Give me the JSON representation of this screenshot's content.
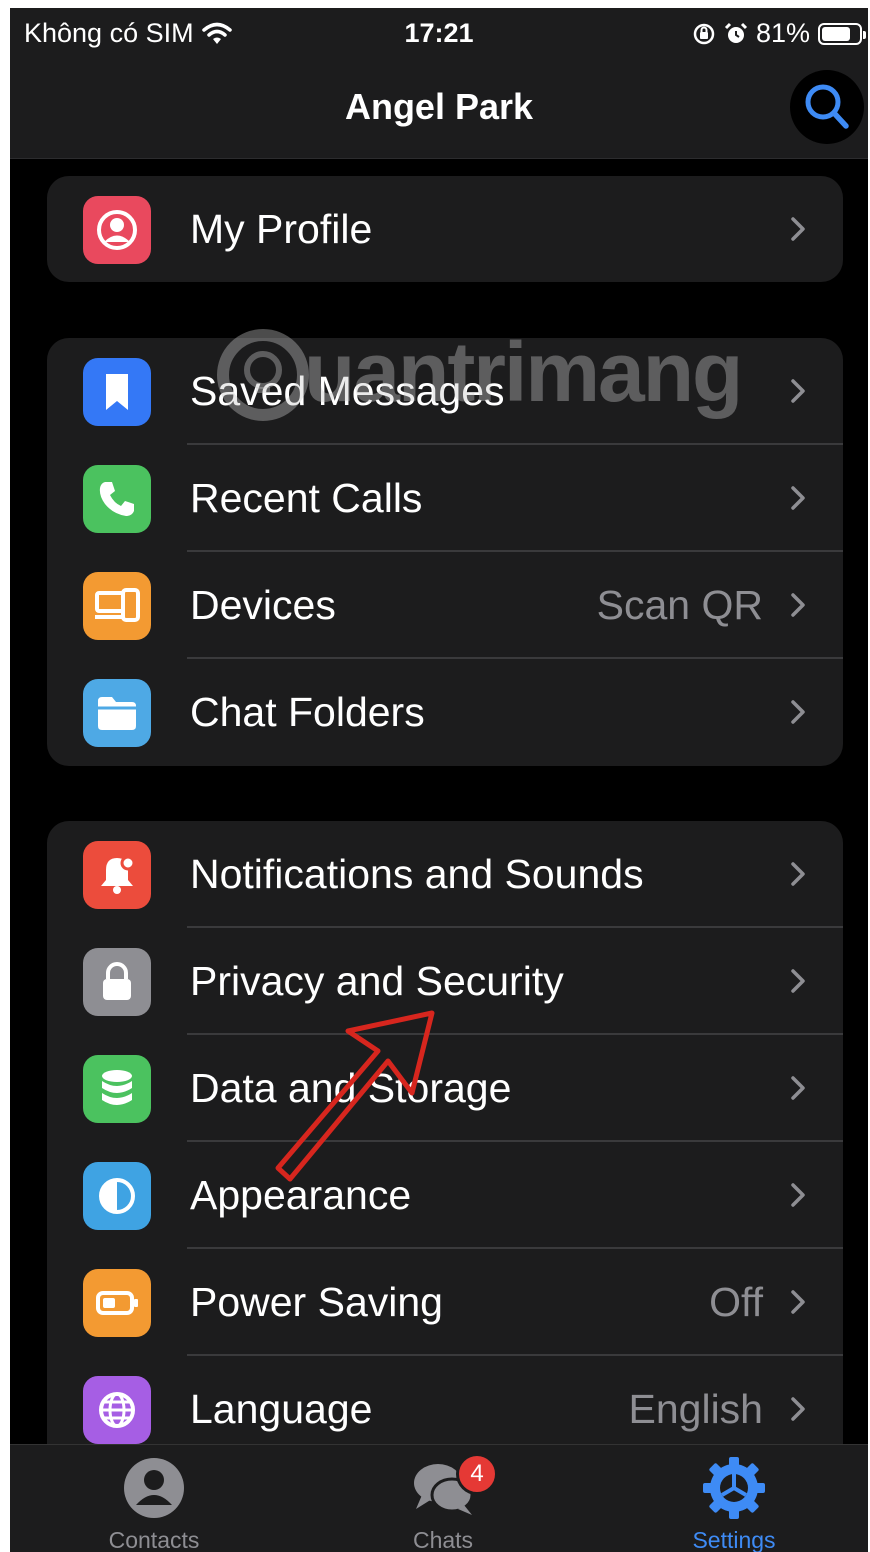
{
  "status": {
    "carrier": "Không có SIM",
    "time": "17:21",
    "battery": "81%",
    "battery_level": 0.81
  },
  "header": {
    "title": "Angel Park",
    "search_icon": "search-icon"
  },
  "groups": [
    {
      "items": [
        {
          "label": "My Profile",
          "icon": "person-icon",
          "color": "#e9495e"
        }
      ]
    },
    {
      "items": [
        {
          "label": "Saved Messages",
          "icon": "bookmark-icon",
          "color": "#3478f6"
        },
        {
          "label": "Recent Calls",
          "icon": "phone-icon",
          "color": "#4bc25f"
        },
        {
          "label": "Devices",
          "value": "Scan QR",
          "icon": "devices-icon",
          "color": "#f39a32"
        },
        {
          "label": "Chat Folders",
          "icon": "folder-icon",
          "color": "#4ea9e5"
        }
      ]
    },
    {
      "items": [
        {
          "label": "Notifications and Sounds",
          "icon": "bell-icon",
          "color": "#ec4c3c"
        },
        {
          "label": "Privacy and Security",
          "icon": "lock-icon",
          "color": "#8e8e93"
        },
        {
          "label": "Data and Storage",
          "icon": "database-icon",
          "color": "#4bc25f"
        },
        {
          "label": "Appearance",
          "icon": "contrast-icon",
          "color": "#3fa3e3"
        },
        {
          "label": "Power Saving",
          "value": "Off",
          "icon": "battery-icon",
          "color": "#f39a32"
        },
        {
          "label": "Language",
          "value": "English",
          "icon": "globe-icon",
          "color": "#a65ee4"
        }
      ]
    }
  ],
  "watermark": "uantrimang",
  "tabbar": {
    "contacts": "Contacts",
    "chats": "Chats",
    "chats_badge": "4",
    "settings": "Settings",
    "active_color": "#3e8bf5"
  }
}
